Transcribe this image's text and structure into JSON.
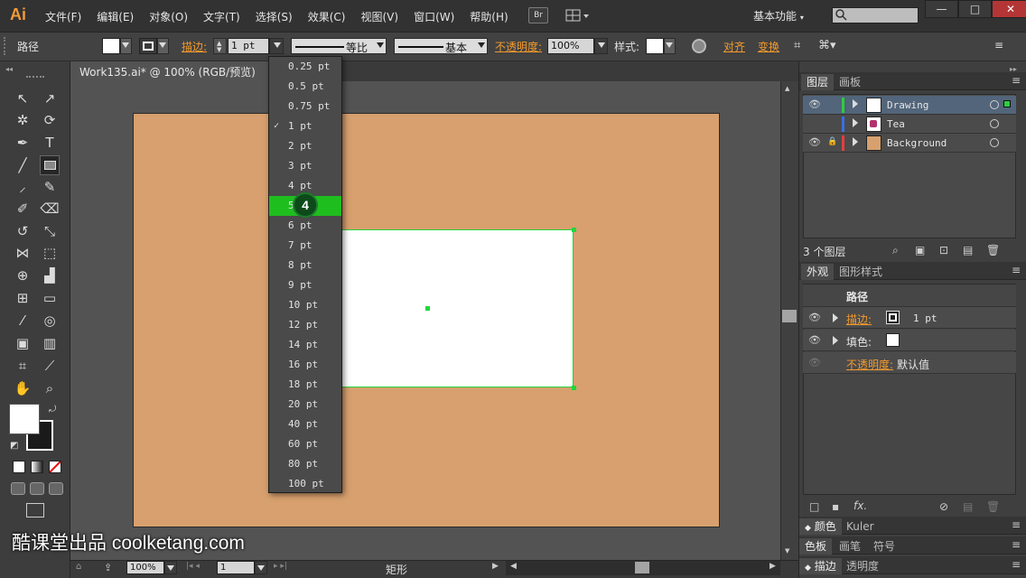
{
  "menubar": {
    "logo": "Ai",
    "items": [
      "文件(F)",
      "编辑(E)",
      "对象(O)",
      "文字(T)",
      "选择(S)",
      "效果(C)",
      "视图(V)",
      "窗口(W)",
      "帮助(H)"
    ],
    "bridge_label": "Br",
    "workspace": "基本功能",
    "window_controls": [
      "—",
      "□",
      "✕"
    ]
  },
  "controlbar": {
    "object_type": "路径",
    "stroke_label": "描边:",
    "stroke_value": "1 pt",
    "profile_label": "等比",
    "brush_label": "基本",
    "opacity_label": "不透明度:",
    "opacity_value": "100%",
    "style_label": "样式:",
    "align_label": "对齐",
    "transform_label": "变换"
  },
  "document": {
    "tab_title": "Work135.ai* @ 100% (RGB/预览)",
    "tab_close": "×",
    "artboard_color": "#d7a06e"
  },
  "stroke_dropdown": {
    "items": [
      "0.25 pt",
      "0.5 pt",
      "0.75 pt",
      "1 pt",
      "2 pt",
      "3 pt",
      "4 pt",
      "5 pt",
      "6 pt",
      "7 pt",
      "8 pt",
      "9 pt",
      "10 pt",
      "12 pt",
      "14 pt",
      "16 pt",
      "18 pt",
      "20 pt",
      "40 pt",
      "60 pt",
      "80 pt",
      "100 pt"
    ],
    "checked": "1 pt",
    "highlighted": "5 pt",
    "highlight_color": "#1fbe1f",
    "step_badge": "4"
  },
  "layers_panel": {
    "tabs": [
      "图层",
      "画板"
    ],
    "layers": [
      {
        "name": "Drawing",
        "color": "#2ecc40"
      },
      {
        "name": "Tea",
        "color": "#3b6fe0"
      },
      {
        "name": "Background",
        "color": "#e04040"
      }
    ],
    "count_label": "3 个图层"
  },
  "appearance_panel": {
    "tabs": [
      "外观",
      "图形样式"
    ],
    "title": "路径",
    "stroke_label": "描边:",
    "stroke_value": "1 pt",
    "fill_label": "填色:",
    "opacity_label": "不透明度:",
    "opacity_value": "默认值",
    "fx_label": "fx."
  },
  "bottom_panels": {
    "row1": [
      "颜色",
      "Kuler"
    ],
    "row2": [
      "色板",
      "画笔",
      "符号"
    ],
    "row3": [
      "描边",
      "透明度"
    ]
  },
  "statusbar": {
    "zoom": "100%",
    "page": "1",
    "tool_name": "矩形"
  },
  "watermark": "酷课堂出品 coolketang.com"
}
